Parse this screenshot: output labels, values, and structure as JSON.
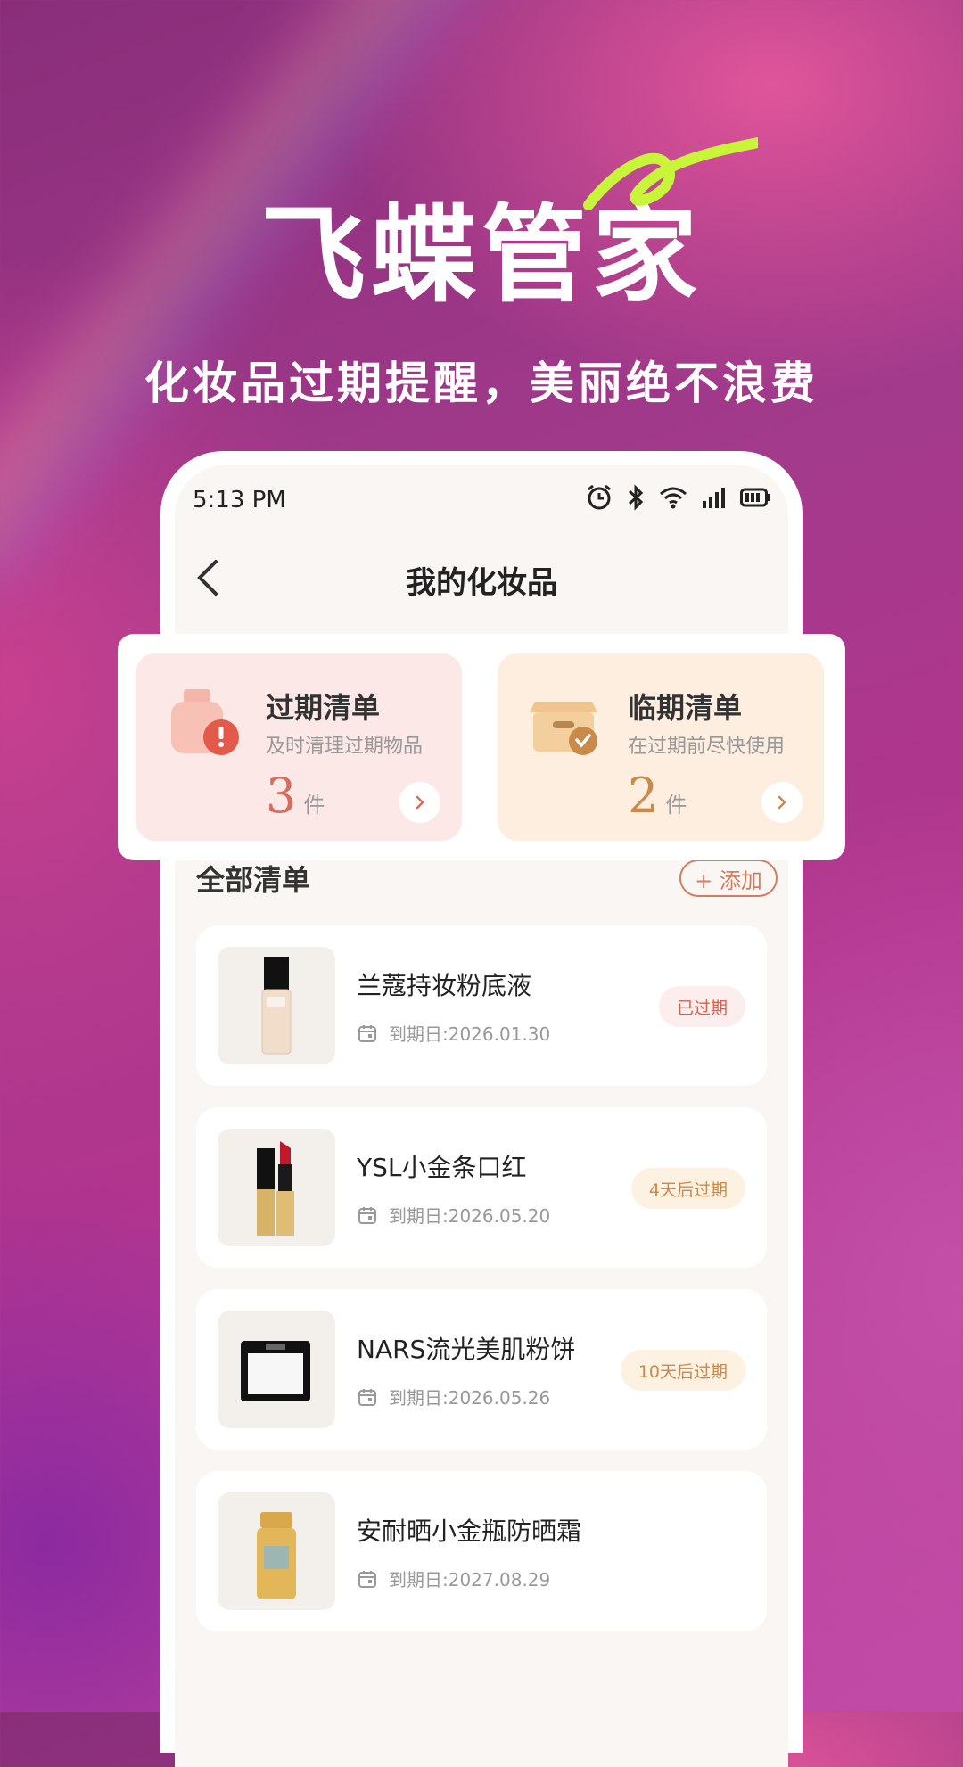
{
  "promo": {
    "app_name": "飞蝶管家",
    "tagline": "化妆品过期提醒，美丽绝不浪费"
  },
  "status_bar": {
    "time": "5:13 PM",
    "icons": [
      "alarm-icon",
      "bluetooth-icon",
      "wifi-icon",
      "signal-icon",
      "battery-icon"
    ]
  },
  "header": {
    "title": "我的化妆品"
  },
  "summary": {
    "expired": {
      "title": "过期清单",
      "desc": "及时清理过期物品",
      "count": "3",
      "unit": "件"
    },
    "near_expiry": {
      "title": "临期清单",
      "desc": "在过期前尽快使用",
      "count": "2",
      "unit": "件"
    }
  },
  "list_section": {
    "title": "全部清单",
    "add_label": "+ 添加"
  },
  "items": [
    {
      "name": "兰蔻持妆粉底液",
      "date": "到期日:2026.01.30",
      "badge": "已过期",
      "status": "expired",
      "thumb_icon": "foundation-bottle-icon"
    },
    {
      "name": "YSL小金条口红",
      "date": "到期日:2026.05.20",
      "badge": "4天后过期",
      "status": "near",
      "thumb_icon": "lipstick-icon"
    },
    {
      "name": "NARS流光美肌粉饼",
      "date": "到期日:2026.05.26",
      "badge": "10天后过期",
      "status": "near",
      "thumb_icon": "compact-powder-icon"
    },
    {
      "name": "安耐晒小金瓶防晒霜",
      "date": "到期日:2027.08.29",
      "badge": "",
      "status": "ok",
      "thumb_icon": "sunscreen-bottle-icon"
    }
  ],
  "colors": {
    "accent": "#d47d5f",
    "expired": "#d4604f",
    "near": "#c98a4a",
    "lime": "#c8f53a"
  }
}
